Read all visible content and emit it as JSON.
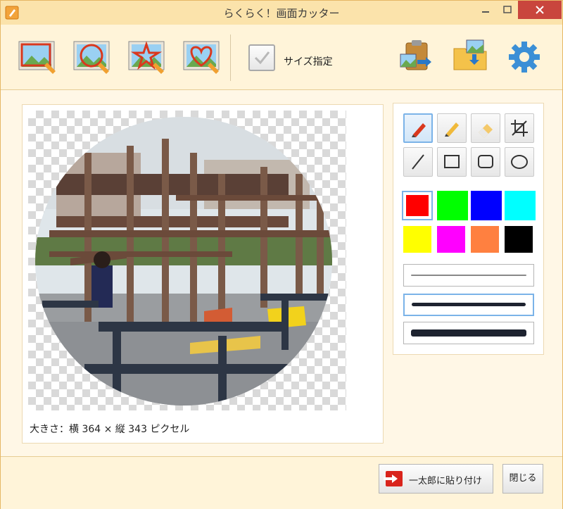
{
  "window": {
    "title": "らくらく！画面カッター"
  },
  "toolbar": {
    "buttons": [
      {
        "name": "rect-capture",
        "icon": "rectangle-capture-icon"
      },
      {
        "name": "circle-capture",
        "icon": "circle-capture-icon"
      },
      {
        "name": "star-capture",
        "icon": "star-capture-icon"
      },
      {
        "name": "heart-capture",
        "icon": "heart-capture-icon"
      }
    ],
    "size_checkbox_label": "サイズ指定",
    "size_checkbox_checked": true,
    "right_icons": [
      "clipboard-paste-icon",
      "save-folder-icon",
      "gear-icon"
    ]
  },
  "preview": {
    "size_text": "大きさ：横 364 × 縦 343 ピクセル"
  },
  "tools": {
    "drawing": [
      "pen-icon",
      "highlighter-icon",
      "eraser-icon",
      "crop-icon",
      "line-icon",
      "rectangle-icon",
      "rounded-rectangle-icon",
      "ellipse-icon"
    ],
    "active_tool": "pen-icon",
    "colors": [
      "#ff0000",
      "#00ff00",
      "#0000ff",
      "#00ffff",
      "#ffff00",
      "#ff00ff",
      "#ff8040",
      "#000000"
    ],
    "active_color": "#ff0000",
    "line_widths": [
      "thin",
      "medium",
      "thick"
    ],
    "active_line_width": "medium"
  },
  "footer": {
    "paste_button_label": "一太郎に貼り付け",
    "close_button_label": "閉じる"
  }
}
